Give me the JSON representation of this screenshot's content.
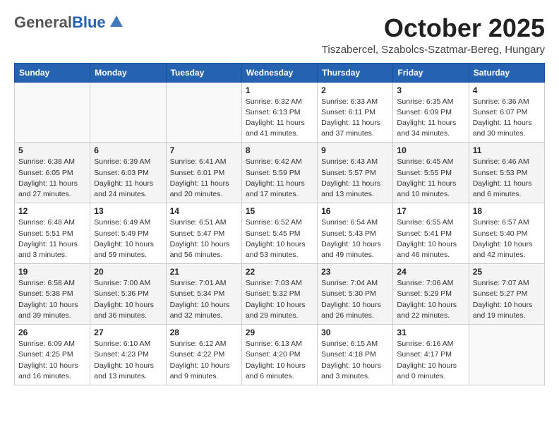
{
  "header": {
    "logo_general": "General",
    "logo_blue": "Blue",
    "month_title": "October 2025",
    "location": "Tiszabercel, Szabolcs-Szatmar-Bereg, Hungary"
  },
  "weekdays": [
    "Sunday",
    "Monday",
    "Tuesday",
    "Wednesday",
    "Thursday",
    "Friday",
    "Saturday"
  ],
  "weeks": [
    [
      {
        "day": "",
        "info": ""
      },
      {
        "day": "",
        "info": ""
      },
      {
        "day": "",
        "info": ""
      },
      {
        "day": "1",
        "info": "Sunrise: 6:32 AM\nSunset: 6:13 PM\nDaylight: 11 hours\nand 41 minutes."
      },
      {
        "day": "2",
        "info": "Sunrise: 6:33 AM\nSunset: 6:11 PM\nDaylight: 11 hours\nand 37 minutes."
      },
      {
        "day": "3",
        "info": "Sunrise: 6:35 AM\nSunset: 6:09 PM\nDaylight: 11 hours\nand 34 minutes."
      },
      {
        "day": "4",
        "info": "Sunrise: 6:36 AM\nSunset: 6:07 PM\nDaylight: 11 hours\nand 30 minutes."
      }
    ],
    [
      {
        "day": "5",
        "info": "Sunrise: 6:38 AM\nSunset: 6:05 PM\nDaylight: 11 hours\nand 27 minutes."
      },
      {
        "day": "6",
        "info": "Sunrise: 6:39 AM\nSunset: 6:03 PM\nDaylight: 11 hours\nand 24 minutes."
      },
      {
        "day": "7",
        "info": "Sunrise: 6:41 AM\nSunset: 6:01 PM\nDaylight: 11 hours\nand 20 minutes."
      },
      {
        "day": "8",
        "info": "Sunrise: 6:42 AM\nSunset: 5:59 PM\nDaylight: 11 hours\nand 17 minutes."
      },
      {
        "day": "9",
        "info": "Sunrise: 6:43 AM\nSunset: 5:57 PM\nDaylight: 11 hours\nand 13 minutes."
      },
      {
        "day": "10",
        "info": "Sunrise: 6:45 AM\nSunset: 5:55 PM\nDaylight: 11 hours\nand 10 minutes."
      },
      {
        "day": "11",
        "info": "Sunrise: 6:46 AM\nSunset: 5:53 PM\nDaylight: 11 hours\nand 6 minutes."
      }
    ],
    [
      {
        "day": "12",
        "info": "Sunrise: 6:48 AM\nSunset: 5:51 PM\nDaylight: 11 hours\nand 3 minutes."
      },
      {
        "day": "13",
        "info": "Sunrise: 6:49 AM\nSunset: 5:49 PM\nDaylight: 10 hours\nand 59 minutes."
      },
      {
        "day": "14",
        "info": "Sunrise: 6:51 AM\nSunset: 5:47 PM\nDaylight: 10 hours\nand 56 minutes."
      },
      {
        "day": "15",
        "info": "Sunrise: 6:52 AM\nSunset: 5:45 PM\nDaylight: 10 hours\nand 53 minutes."
      },
      {
        "day": "16",
        "info": "Sunrise: 6:54 AM\nSunset: 5:43 PM\nDaylight: 10 hours\nand 49 minutes."
      },
      {
        "day": "17",
        "info": "Sunrise: 6:55 AM\nSunset: 5:41 PM\nDaylight: 10 hours\nand 46 minutes."
      },
      {
        "day": "18",
        "info": "Sunrise: 6:57 AM\nSunset: 5:40 PM\nDaylight: 10 hours\nand 42 minutes."
      }
    ],
    [
      {
        "day": "19",
        "info": "Sunrise: 6:58 AM\nSunset: 5:38 PM\nDaylight: 10 hours\nand 39 minutes."
      },
      {
        "day": "20",
        "info": "Sunrise: 7:00 AM\nSunset: 5:36 PM\nDaylight: 10 hours\nand 36 minutes."
      },
      {
        "day": "21",
        "info": "Sunrise: 7:01 AM\nSunset: 5:34 PM\nDaylight: 10 hours\nand 32 minutes."
      },
      {
        "day": "22",
        "info": "Sunrise: 7:03 AM\nSunset: 5:32 PM\nDaylight: 10 hours\nand 29 minutes."
      },
      {
        "day": "23",
        "info": "Sunrise: 7:04 AM\nSunset: 5:30 PM\nDaylight: 10 hours\nand 26 minutes."
      },
      {
        "day": "24",
        "info": "Sunrise: 7:06 AM\nSunset: 5:29 PM\nDaylight: 10 hours\nand 22 minutes."
      },
      {
        "day": "25",
        "info": "Sunrise: 7:07 AM\nSunset: 5:27 PM\nDaylight: 10 hours\nand 19 minutes."
      }
    ],
    [
      {
        "day": "26",
        "info": "Sunrise: 6:09 AM\nSunset: 4:25 PM\nDaylight: 10 hours\nand 16 minutes."
      },
      {
        "day": "27",
        "info": "Sunrise: 6:10 AM\nSunset: 4:23 PM\nDaylight: 10 hours\nand 13 minutes."
      },
      {
        "day": "28",
        "info": "Sunrise: 6:12 AM\nSunset: 4:22 PM\nDaylight: 10 hours\nand 9 minutes."
      },
      {
        "day": "29",
        "info": "Sunrise: 6:13 AM\nSunset: 4:20 PM\nDaylight: 10 hours\nand 6 minutes."
      },
      {
        "day": "30",
        "info": "Sunrise: 6:15 AM\nSunset: 4:18 PM\nDaylight: 10 hours\nand 3 minutes."
      },
      {
        "day": "31",
        "info": "Sunrise: 6:16 AM\nSunset: 4:17 PM\nDaylight: 10 hours\nand 0 minutes."
      },
      {
        "day": "",
        "info": ""
      }
    ]
  ]
}
